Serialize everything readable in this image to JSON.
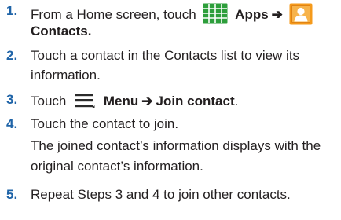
{
  "step1": {
    "number": "1.",
    "prefix": "From a Home screen, touch",
    "apps_label": "Apps",
    "arrow": "➔",
    "contacts_label": "Contacts."
  },
  "step2": {
    "number": "2.",
    "line1": "Touch a contact in the Contacts list to view its",
    "line2": "information."
  },
  "step3": {
    "number": "3.",
    "prefix": "Touch",
    "menu_label": "Menu",
    "arrow": "➔",
    "join_label": "Join contact",
    "suffix": "."
  },
  "step4": {
    "number": "4.",
    "line1": "Touch the contact to join.",
    "note_line1": "The joined contact’s information displays with the",
    "note_line2": "original contact’s information."
  },
  "step5": {
    "number": "5.",
    "line1": "Repeat Steps 3 and 4 to join other contacts."
  },
  "colors": {
    "step_number": "#1f64a8",
    "text": "#231f20",
    "apps_icon": "#2d9e3b",
    "contacts_icon_bg": "#f59a1b"
  },
  "icons": {
    "apps": "apps-grid-icon",
    "contacts": "contacts-icon",
    "menu": "menu-icon"
  }
}
